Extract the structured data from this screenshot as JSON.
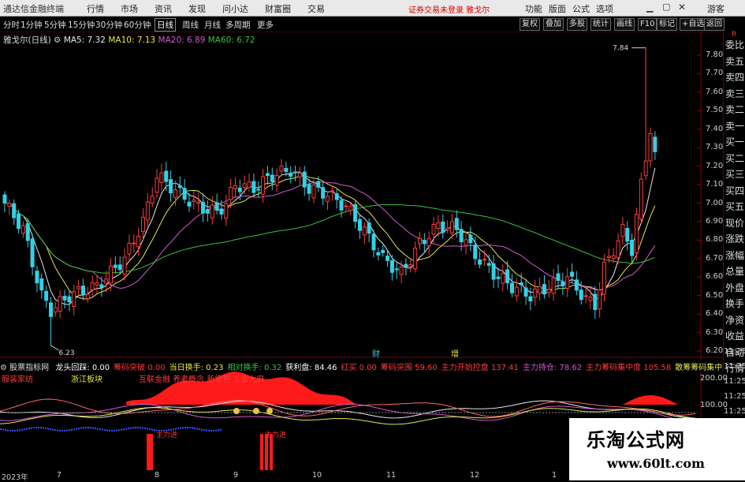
{
  "app": {
    "title": "通达信金融终端",
    "warning": "证券交易未登录 雅戈尔",
    "guest": "游客"
  },
  "menu": [
    "行情",
    "市场",
    "资讯",
    "发现",
    "问小达",
    "财富圈",
    "交易"
  ],
  "right_menu": [
    "功能",
    "版面",
    "公式",
    "选项"
  ],
  "periods": [
    "分时",
    "1分钟",
    "5分钟",
    "15分钟",
    "30分钟",
    "60分钟",
    "日线",
    "周线",
    "月线",
    "多周期",
    "更多"
  ],
  "active_period": "日线",
  "toolbar": [
    "复权",
    "叠加",
    "多股",
    "统计",
    "画线",
    "F10",
    "标记",
    "+自选",
    "返回"
  ],
  "stock": {
    "name": "雅戈尔(日线)",
    "ma5": "MA5: 7.32",
    "ma10": "MA10: 7.13",
    "ma20": "MA20: 6.89",
    "ma60": "MA60: 6.72"
  },
  "colors": {
    "up": "#ff3b3b",
    "down": "#33d1e6",
    "ma5": "#e8e8e8",
    "ma10": "#e6e64c",
    "ma20": "#d05ad0",
    "ma60": "#3fbf3f",
    "grid": "#7a0000"
  },
  "price_axis": [
    "7.80",
    "7.70",
    "7.60",
    "7.50",
    "7.40",
    "7.30",
    "7.20",
    "7.10",
    "7.00",
    "6.90",
    "6.80",
    "6.70",
    "6.60",
    "6.50",
    "6.40",
    "6.30",
    "6.20"
  ],
  "annotations": {
    "high": "7.84",
    "low": "6.23",
    "marker_cai": "财",
    "marker_zeng": "增"
  },
  "indicator": {
    "name": "股票指标网",
    "items": [
      {
        "label": "龙头回踩:",
        "value": "0.00",
        "color": "#ffffff"
      },
      {
        "label": "筹码突破",
        "value": "0.00",
        "color": "#ff3b3b"
      },
      {
        "label": "当日换手:",
        "value": "0.23",
        "color": "#e6e64c"
      },
      {
        "label": "相对换手:",
        "value": "0.32",
        "color": "#3fbf3f"
      },
      {
        "label": "获利盘:",
        "value": "84.46",
        "color": "#ffffff"
      },
      {
        "label": "红买",
        "value": "0.00",
        "color": "#ff3b3b"
      },
      {
        "label": "筹码突围",
        "value": "59.60",
        "color": "#ff3b3b"
      },
      {
        "label": "主力开始控盘",
        "value": "137.41",
        "color": "#ff3b3b"
      },
      {
        "label": "主力持仓:",
        "value": "78.62",
        "color": "#d05ad0"
      },
      {
        "label": "主力筹码集中度",
        "value": "105.58",
        "color": "#ff3b3b"
      },
      {
        "label": "散筹筹码集中度:",
        "value": "",
        "color": "#e6e64c"
      }
    ]
  },
  "concepts": {
    "industry": "服装家纺",
    "region": "浙江板块",
    "tags": "互联金融 养老概念 新零售 工业大麻"
  },
  "sub_axis": [
    "200.00",
    "100.00"
  ],
  "sub_labels": {
    "l1": "主力进",
    "l2": "主力进"
  },
  "side_panel": [
    "委比",
    "卖五",
    "卖四",
    "卖三",
    "卖二",
    "卖一",
    "买一",
    "买二",
    "买三",
    "买四",
    "买五",
    "现价",
    "涨跌",
    "涨幅",
    "总量",
    "外盘",
    "换手",
    "净资",
    "收益",
    "自动",
    "行情"
  ],
  "side_top": "R",
  "dates": [
    {
      "t": "2023年"
    },
    {
      "t": "7"
    },
    {
      "t": "8"
    },
    {
      "t": "9"
    },
    {
      "t": "10"
    },
    {
      "t": "11"
    },
    {
      "t": "12"
    },
    {
      "t": "1"
    }
  ],
  "right_times": [
    "11:25",
    "11:25",
    "11:25",
    "11:25",
    "11:25",
    "11:25",
    "11:25"
  ],
  "watermark": {
    "cn": "乐淘公式网",
    "url": "www.60lt.com"
  }
}
